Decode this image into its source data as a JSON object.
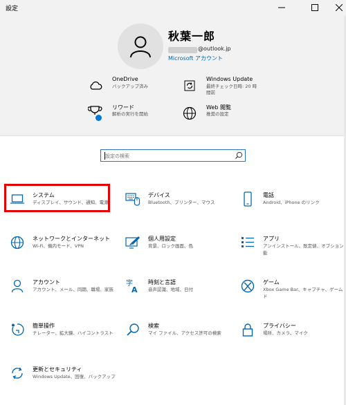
{
  "window": {
    "title": "設定"
  },
  "profile": {
    "name": "秋葉一郎",
    "email": "@outlook.jp",
    "account_link": "Microsoft アカウント"
  },
  "header_items": [
    {
      "name": "OneDrive",
      "desc": "バックアップ済み",
      "icon": "cloud-icon"
    },
    {
      "name": "Windows Update",
      "desc": "最終チェック日時: 20 時\n間前",
      "icon": "refresh-icon"
    },
    {
      "name": "リワード",
      "desc": "解析の実行を開始",
      "icon": "trophy-icon"
    },
    {
      "name": "Web 閲覧",
      "desc": "推奨の設定",
      "icon": "globe-icon"
    }
  ],
  "search": {
    "placeholder": "設定の検索"
  },
  "tiles": [
    {
      "name": "システム",
      "desc": "ディスプレイ、サウンド、通知、電源",
      "icon": "laptop-icon"
    },
    {
      "name": "デバイス",
      "desc": "Bluetooth、プリンター、マウス",
      "icon": "keyboard-icon"
    },
    {
      "name": "電話",
      "desc": "Android、iPhone のリンク",
      "icon": "phone-icon"
    },
    {
      "name": "ネットワークとインターネット",
      "desc": "Wi-Fi、機内モード、VPN",
      "icon": "globe-icon"
    },
    {
      "name": "個人用設定",
      "desc": "背景、ロック画面、色",
      "icon": "paint-icon"
    },
    {
      "name": "アプリ",
      "desc": "アンインストール、既定値、オプションの機能",
      "icon": "apps-list-icon"
    },
    {
      "name": "アカウント",
      "desc": "アカウント、メール、同期、職場、家族",
      "icon": "person-icon"
    },
    {
      "name": "時刻と言語",
      "desc": "音声認識、地域、日付",
      "icon": "language-icon"
    },
    {
      "name": "ゲーム",
      "desc": "Xbox Game Bar、キャプチャ、ゲーム モード",
      "icon": "xbox-icon"
    },
    {
      "name": "簡単操作",
      "desc": "ナレーター、拡大鏡、ハイコントラスト",
      "icon": "accessibility-icon"
    },
    {
      "name": "検索",
      "desc": "マイ ファイル、アクセス許可の検索",
      "icon": "search-icon"
    },
    {
      "name": "プライバシー",
      "desc": "場所、カメラ、マイク",
      "icon": "lock-icon"
    },
    {
      "name": "更新とセキュリティ",
      "desc": "Windows Update、回復、バックアップ",
      "icon": "update-icon"
    }
  ],
  "colors": {
    "accent": "#0066b4",
    "highlight": "#e60000",
    "header_bg": "#f2f2f2"
  }
}
